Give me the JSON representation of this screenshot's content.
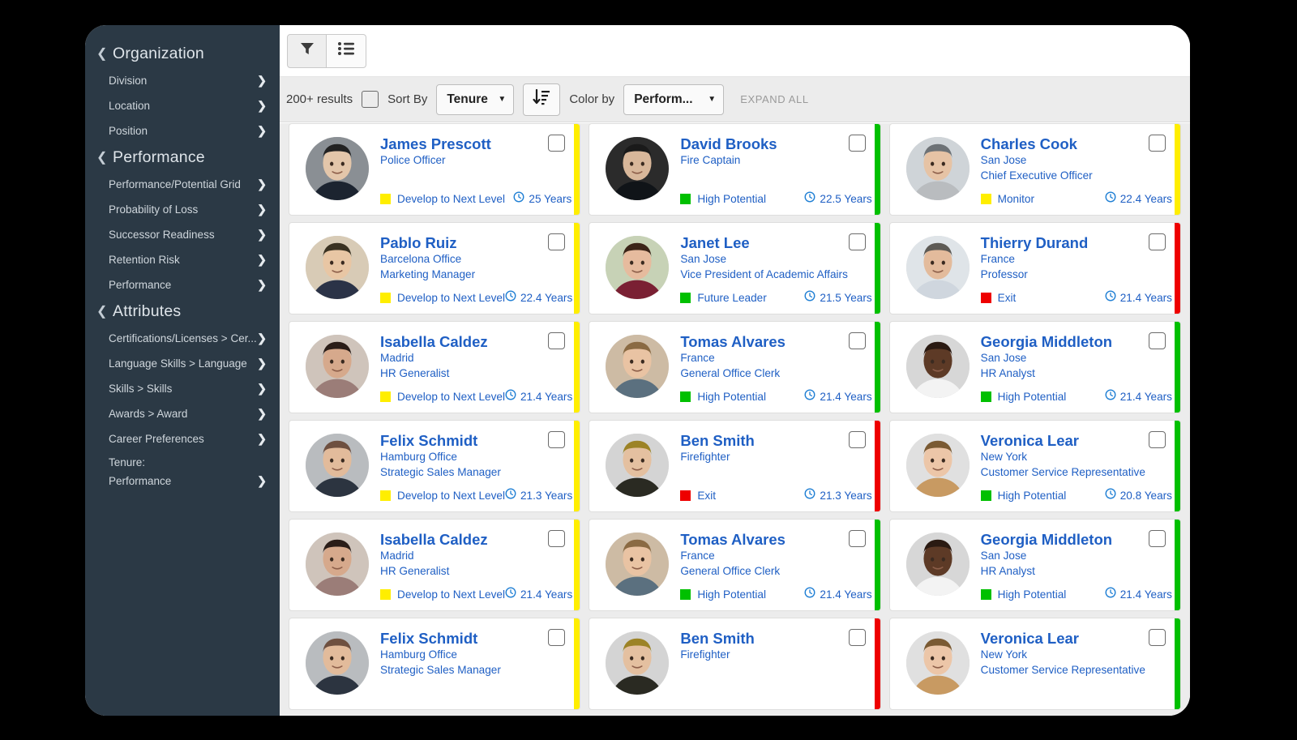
{
  "sidebar": {
    "groups": [
      {
        "label": "Organization",
        "icon": "chevron-left-icon",
        "items": [
          {
            "label": "Division",
            "icon": "chevron-right-icon"
          },
          {
            "label": "Location",
            "icon": "chevron-right-icon"
          },
          {
            "label": "Position",
            "icon": "chevron-right-icon"
          }
        ]
      },
      {
        "label": "Performance",
        "icon": "chevron-left-icon",
        "items": [
          {
            "label": "Performance/Potential Grid",
            "icon": "chevron-right-icon"
          },
          {
            "label": "Probability of Loss",
            "icon": "chevron-right-icon"
          },
          {
            "label": "Successor Readiness",
            "icon": "chevron-right-icon"
          },
          {
            "label": "Retention Risk",
            "icon": "chevron-right-icon"
          },
          {
            "label": "Performance",
            "icon": "chevron-right-icon"
          }
        ]
      },
      {
        "label": "Attributes",
        "icon": "chevron-left-icon",
        "items": [
          {
            "label": "Certifications/Licenses > Cer...",
            "icon": "chevron-right-icon"
          },
          {
            "label": "Language Skills > Language",
            "icon": "chevron-right-icon"
          },
          {
            "label": "Skills > Skills",
            "icon": "chevron-right-icon"
          },
          {
            "label": "Awards > Award",
            "icon": "chevron-right-icon"
          },
          {
            "label": "Career Preferences",
            "icon": "chevron-right-icon"
          },
          {
            "label": "Tenure:",
            "icon": ""
          },
          {
            "label": "Performance",
            "icon": "chevron-right-icon"
          }
        ]
      }
    ]
  },
  "toolbar": {
    "buttons": [
      {
        "name": "filter-icon",
        "title": "Filter"
      },
      {
        "name": "list-icon",
        "title": "List view"
      }
    ]
  },
  "filterbar": {
    "results_text": "200+ results",
    "select_all_checked": false,
    "sort_by_label": "Sort By",
    "sort_by_value": "Tenure",
    "sort_direction_icon": "sort-descending-icon",
    "color_by_label": "Color by",
    "color_by_value": "Perform...",
    "expand_all_label": "EXPAND ALL"
  },
  "legend_colors": {
    "yellow": "#ffee00",
    "green": "#00c000",
    "red": "#ee0000"
  },
  "cards": [
    [
      {
        "name": "James Prescott",
        "location": "",
        "title": "Police Officer",
        "rating": "Develop to Next Level",
        "rating_color": "#ffee00",
        "tenure": "25 Years",
        "accent": "#ffee00",
        "checked": false,
        "photo": "police-officer-photo"
      },
      {
        "name": "David Brooks",
        "location": "",
        "title": "Fire Captain",
        "rating": "High Potential",
        "rating_color": "#00c000",
        "tenure": "22.5 Years",
        "accent": "#00c000",
        "checked": false,
        "photo": "fire-captain-photo"
      },
      {
        "name": "Charles Cook",
        "location": "San Jose",
        "title": "Chief Executive Officer",
        "rating": "Monitor",
        "rating_color": "#ffee00",
        "tenure": "22.4 Years",
        "accent": "#ffee00",
        "checked": false,
        "photo": "executive-photo"
      }
    ],
    [
      {
        "name": "Pablo Ruiz",
        "location": "Barcelona Office",
        "title": "Marketing Manager",
        "rating": "Develop to Next Level",
        "rating_color": "#ffee00",
        "tenure": "22.4 Years",
        "accent": "#ffee00",
        "checked": false,
        "photo": "marketing-manager-photo"
      },
      {
        "name": "Janet Lee",
        "location": "San Jose",
        "title": "Vice President of Academic Affairs",
        "rating": "Future Leader",
        "rating_color": "#00c000",
        "tenure": "21.5 Years",
        "accent": "#00c000",
        "checked": false,
        "photo": "vice-president-photo"
      },
      {
        "name": "Thierry Durand",
        "location": "France",
        "title": "Professor",
        "rating": "Exit",
        "rating_color": "#ee0000",
        "tenure": "21.4 Years",
        "accent": "#ee0000",
        "checked": false,
        "photo": "professor-photo"
      }
    ],
    [
      {
        "name": "Isabella Caldez",
        "location": "Madrid",
        "title": "HR Generalist",
        "rating": "Develop to Next Level",
        "rating_color": "#ffee00",
        "tenure": "21.4 Years",
        "accent": "#ffee00",
        "checked": false,
        "photo": "hr-generalist-photo"
      },
      {
        "name": "Tomas Alvares",
        "location": "France",
        "title": "General Office Clerk",
        "rating": "High Potential",
        "rating_color": "#00c000",
        "tenure": "21.4 Years",
        "accent": "#00c000",
        "checked": false,
        "photo": "office-clerk-photo"
      },
      {
        "name": "Georgia Middleton",
        "location": "San Jose",
        "title": "HR Analyst",
        "rating": "High Potential",
        "rating_color": "#00c000",
        "tenure": "21.4 Years",
        "accent": "#00c000",
        "checked": false,
        "photo": "hr-analyst-photo"
      }
    ],
    [
      {
        "name": "Felix Schmidt",
        "location": "Hamburg Office",
        "title": "Strategic Sales Manager",
        "rating": "Develop to Next Level",
        "rating_color": "#ffee00",
        "tenure": "21.3 Years",
        "accent": "#ffee00",
        "checked": false,
        "photo": "sales-manager-photo"
      },
      {
        "name": "Ben Smith",
        "location": "",
        "title": "Firefighter",
        "rating": "Exit",
        "rating_color": "#ee0000",
        "tenure": "21.3 Years",
        "accent": "#ee0000",
        "checked": false,
        "photo": "firefighter-photo"
      },
      {
        "name": "Veronica Lear",
        "location": "New York",
        "title": "Customer Service Representative",
        "rating": "High Potential",
        "rating_color": "#00c000",
        "tenure": "20.8 Years",
        "accent": "#00c000",
        "checked": false,
        "photo": "customer-service-photo"
      }
    ],
    [
      {
        "name": "Isabella Caldez",
        "location": "Madrid",
        "title": "HR Generalist",
        "rating": "Develop to Next Level",
        "rating_color": "#ffee00",
        "tenure": "21.4 Years",
        "accent": "#ffee00",
        "checked": false,
        "photo": "hr-generalist-photo"
      },
      {
        "name": "Tomas Alvares",
        "location": "France",
        "title": "General Office Clerk",
        "rating": "High Potential",
        "rating_color": "#00c000",
        "tenure": "21.4 Years",
        "accent": "#00c000",
        "checked": false,
        "photo": "office-clerk-photo"
      },
      {
        "name": "Georgia Middleton",
        "location": "San Jose",
        "title": "HR Analyst",
        "rating": "High Potential",
        "rating_color": "#00c000",
        "tenure": "21.4 Years",
        "accent": "#00c000",
        "checked": false,
        "photo": "hr-analyst-photo"
      }
    ],
    [
      {
        "name": "Felix Schmidt",
        "location": "Hamburg Office",
        "title": "Strategic Sales Manager",
        "rating": "",
        "rating_color": "#ffee00",
        "tenure": "",
        "accent": "#ffee00",
        "checked": false,
        "photo": "sales-manager-photo"
      },
      {
        "name": "Ben Smith",
        "location": "",
        "title": "Firefighter",
        "rating": "",
        "rating_color": "#ee0000",
        "tenure": "",
        "accent": "#ee0000",
        "checked": false,
        "photo": "firefighter-photo"
      },
      {
        "name": "Veronica Lear",
        "location": "New York",
        "title": "Customer Service Representative",
        "rating": "",
        "rating_color": "#00c000",
        "tenure": "",
        "accent": "#00c000",
        "checked": false,
        "photo": "customer-service-photo"
      }
    ]
  ]
}
